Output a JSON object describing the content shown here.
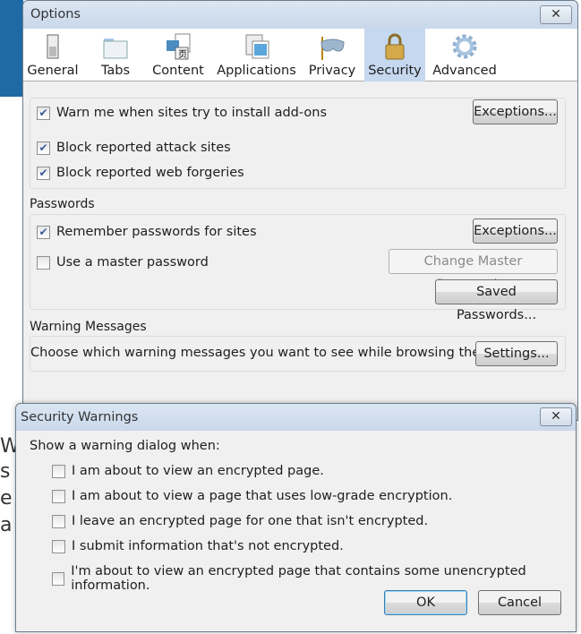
{
  "options": {
    "title": "Options",
    "close_glyph": "✕",
    "tabs": [
      {
        "label": "General",
        "icon": "switch-icon"
      },
      {
        "label": "Tabs",
        "icon": "folder-tab-icon"
      },
      {
        "label": "Content",
        "icon": "content-page-icon"
      },
      {
        "label": "Applications",
        "icon": "applications-icon"
      },
      {
        "label": "Privacy",
        "icon": "mask-icon"
      },
      {
        "label": "Security",
        "icon": "padlock-icon",
        "selected": true
      },
      {
        "label": "Advanced",
        "icon": "gear-icon"
      }
    ],
    "general": {
      "warn_addons": {
        "label": "Warn me when sites try to install add-ons",
        "checked": true
      },
      "exceptions": "Exceptions...",
      "block_attack": {
        "label": "Block reported attack sites",
        "checked": true
      },
      "block_forgeries": {
        "label": "Block reported web forgeries",
        "checked": true
      }
    },
    "passwords": {
      "heading": "Passwords",
      "remember": {
        "label": "Remember passwords for sites",
        "checked": true
      },
      "exceptions": "Exceptions...",
      "master": {
        "label": "Use a master password",
        "checked": false
      },
      "change_master": "Change Master Password...",
      "saved": "Saved Passwords..."
    },
    "warnings": {
      "heading": "Warning Messages",
      "text": "Choose which warning messages you want to see while browsing the web",
      "settings": "Settings..."
    }
  },
  "security_warnings": {
    "title": "Security Warnings",
    "close_glyph": "✕",
    "intro": "Show a warning dialog when:",
    "options": [
      {
        "label": "I am about to view an encrypted page.",
        "checked": false
      },
      {
        "label": "I am about to view a page that uses low-grade encryption.",
        "checked": false
      },
      {
        "label": "I leave an encrypted page for one that isn't encrypted.",
        "checked": false
      },
      {
        "label": "I submit information that's not encrypted.",
        "checked": false
      },
      {
        "label": "I'm about to view an encrypted page that contains some unencrypted information.",
        "checked": false
      }
    ],
    "ok": "OK",
    "cancel": "Cancel"
  },
  "check_glyph": "✔"
}
